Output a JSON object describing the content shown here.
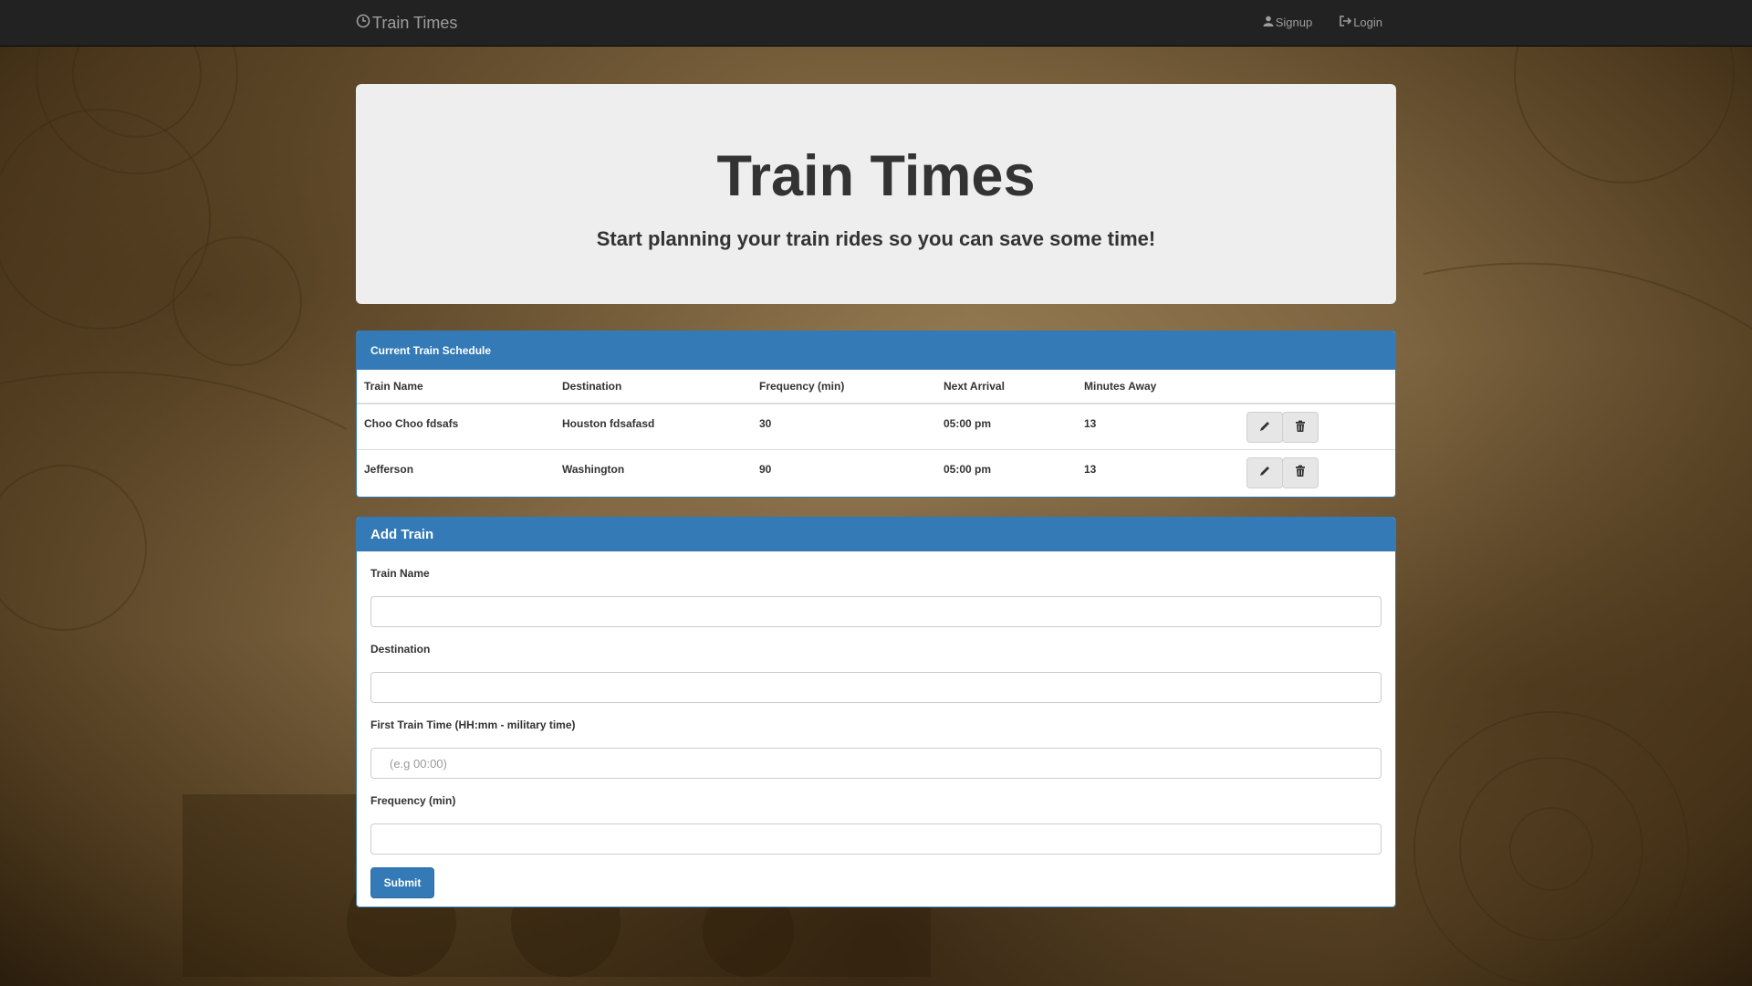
{
  "navbar": {
    "brand": "Train Times",
    "brand_icon": "clock-icon",
    "links": [
      {
        "label": "Signup",
        "icon": "user-icon"
      },
      {
        "label": "Login",
        "icon": "login-icon"
      }
    ]
  },
  "jumbotron": {
    "title": "Train Times",
    "subtitle": "Start planning your train rides so you can save some time!"
  },
  "schedule": {
    "heading": "Current Train Schedule",
    "columns": [
      "Train Name",
      "Destination",
      "Frequency (min)",
      "Next Arrival",
      "Minutes Away"
    ],
    "rows": [
      {
        "name": "Choo Choo fdsafs",
        "destination": "Houston fdsafasd",
        "frequency": "30",
        "next_arrival": "05:00 pm",
        "minutes_away": "13"
      },
      {
        "name": "Jefferson",
        "destination": "Washington",
        "frequency": "90",
        "next_arrival": "05:00 pm",
        "minutes_away": "13"
      }
    ],
    "row_actions": [
      "pencil-icon",
      "trash-icon"
    ]
  },
  "add_train": {
    "heading": "Add Train",
    "fields": [
      {
        "label": "Train Name",
        "value": "",
        "placeholder": ""
      },
      {
        "label": "Destination",
        "value": "",
        "placeholder": ""
      },
      {
        "label": "First Train Time (HH:mm - military time)",
        "value": "",
        "placeholder": "(e.g 00:00)"
      },
      {
        "label": "Frequency (min)",
        "value": "",
        "placeholder": ""
      }
    ],
    "submit_label": "Submit"
  },
  "colors": {
    "navbar": "#222222",
    "primary": "#337ab7",
    "jumbotron": "#eeeeee"
  }
}
